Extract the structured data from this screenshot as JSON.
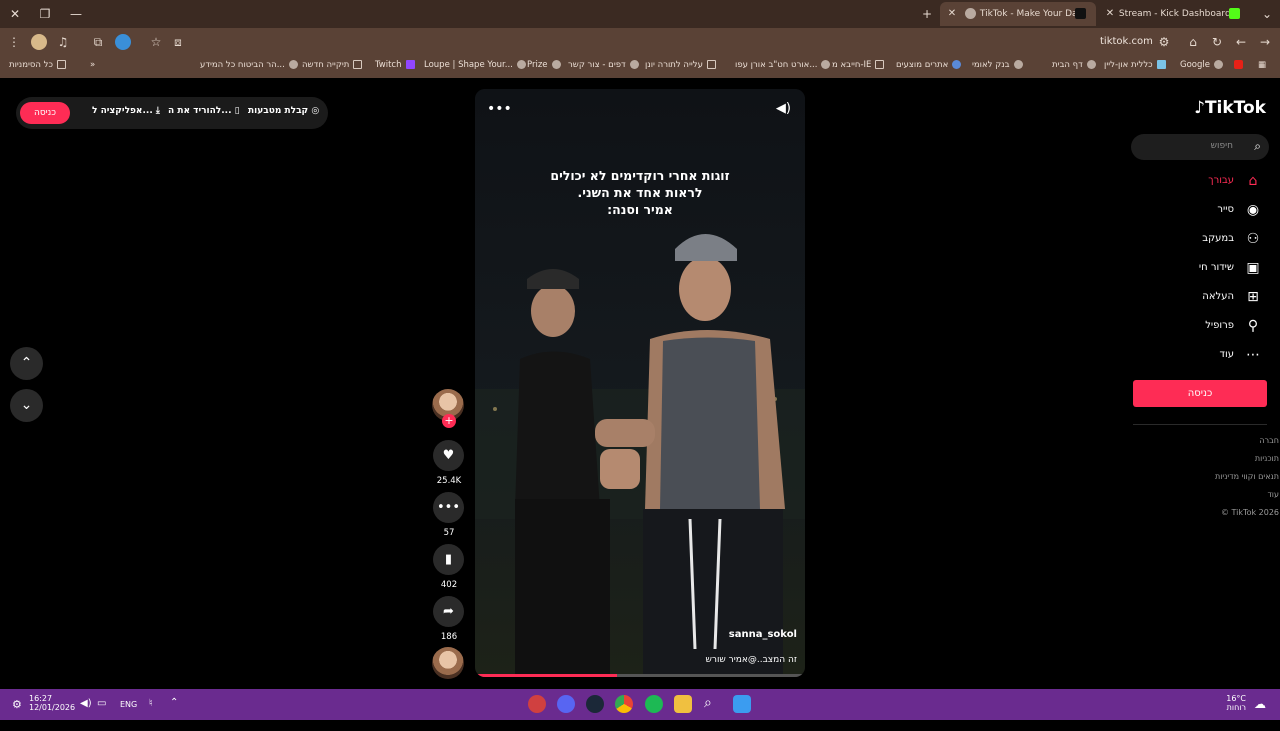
{
  "browser": {
    "tabs": [
      {
        "title": "TikTok - Make Your Day",
        "active": true
      },
      {
        "title": "Stream - Kick Dashboard",
        "active": false
      }
    ],
    "url": "tiktok.com",
    "bookmarks": [
      {
        "label": "Google",
        "icon": "google-icon"
      },
      {
        "label": "כללית און-ליין",
        "icon": "clalit-icon"
      },
      {
        "label": "דף הבית",
        "icon": "globe-icon"
      },
      {
        "label": "בנק לאומי",
        "icon": "globe-icon"
      },
      {
        "label": "אתרים מוצעים",
        "icon": "globe-icon"
      },
      {
        "label": "חייבא מ-IE",
        "icon": "folder-icon"
      },
      {
        "label": "אורט חט\"ב אורן עפו...",
        "icon": "globe-icon"
      },
      {
        "label": "עלייה לתורה יונן",
        "icon": "folder-icon"
      },
      {
        "label": "דפים - צור קשר",
        "icon": "globe-icon"
      },
      {
        "label": "Prize",
        "icon": "globe-icon"
      },
      {
        "label": "Loupe | Shape Your...",
        "icon": "globe-icon"
      },
      {
        "label": "Twitch",
        "icon": "twitch-icon"
      },
      {
        "label": "תיקייה חדשה",
        "icon": "folder-icon"
      },
      {
        "label": "הר הביטוח כל המידע...",
        "icon": "globe-icon"
      },
      {
        "label": "כל הסימניות",
        "icon": "folder-icon"
      }
    ],
    "bookmarks_overflow": "»"
  },
  "topbar": {
    "login_label": "כניסה",
    "app_label": "אפליקציה ל...",
    "download_label": "להוריד את ה...",
    "coins_label": "קבלת מטבעות"
  },
  "video": {
    "caption_lines": [
      "זוגות אחרי רוקדימים לא יכולים",
      "לראות אחד את השני.",
      "אמיר וסנה:"
    ],
    "username": "sanna_sokol",
    "description": "זה המצב..@אמיר שורש",
    "progress": 0.43
  },
  "actions": {
    "likes": "25.4K",
    "comments": "57",
    "saves": "402",
    "shares": "186"
  },
  "sidebar": {
    "logo": "TikTok",
    "search_placeholder": "חיפוש",
    "nav": [
      {
        "label": "עבורך",
        "icon": "home-icon",
        "active": true
      },
      {
        "label": "סייר",
        "icon": "compass-icon",
        "active": false
      },
      {
        "label": "במעקב",
        "icon": "following-icon",
        "active": false
      },
      {
        "label": "שידור חי",
        "icon": "live-icon",
        "active": false
      },
      {
        "label": "העלאה",
        "icon": "upload-icon",
        "active": false
      },
      {
        "label": "פרופיל",
        "icon": "profile-icon",
        "active": false
      },
      {
        "label": "עוד",
        "icon": "more-icon",
        "active": false
      }
    ],
    "login_label": "כניסה",
    "footer": [
      "חברה",
      "תוכניות",
      "תנאים וקווי מדיניות",
      "עוד",
      "© TikTok 2026"
    ]
  },
  "taskbar": {
    "time": "16:27",
    "date": "12/01/2026",
    "lang": "ENG",
    "weather_temp": "16°C",
    "weather_desc": "רוחות"
  },
  "colors": {
    "accent": "#fe2c55",
    "titlebar": "#3b2a22",
    "toolbar": "#5a4236",
    "taskbar": "#6a2b8f"
  }
}
